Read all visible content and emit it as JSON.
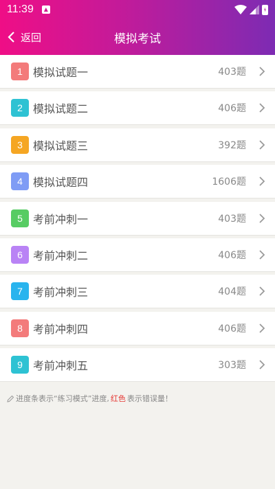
{
  "status": {
    "time": "11:39"
  },
  "nav": {
    "back_label": "返回",
    "title": "模拟考试"
  },
  "items": [
    {
      "num": "1",
      "label": "模拟试题一",
      "count": "403题",
      "color": "#f37b7b"
    },
    {
      "num": "2",
      "label": "模拟试题二",
      "count": "406题",
      "color": "#2ec2d3"
    },
    {
      "num": "3",
      "label": "模拟试题三",
      "count": "392题",
      "color": "#f5a623"
    },
    {
      "num": "4",
      "label": "模拟试题四",
      "count": "1606题",
      "color": "#7f9cf5"
    },
    {
      "num": "5",
      "label": "考前冲刺一",
      "count": "403题",
      "color": "#57cc63"
    },
    {
      "num": "6",
      "label": "考前冲刺二",
      "count": "406题",
      "color": "#b983f5"
    },
    {
      "num": "7",
      "label": "考前冲刺三",
      "count": "404题",
      "color": "#29b4ee"
    },
    {
      "num": "8",
      "label": "考前冲刺四",
      "count": "406题",
      "color": "#f37b7b"
    },
    {
      "num": "9",
      "label": "考前冲刺五",
      "count": "303题",
      "color": "#2ec2d3"
    }
  ],
  "note": {
    "prefix": "进度条表示“练习模式”进度,",
    "red": "红色",
    "suffix": "表示错误量！"
  }
}
